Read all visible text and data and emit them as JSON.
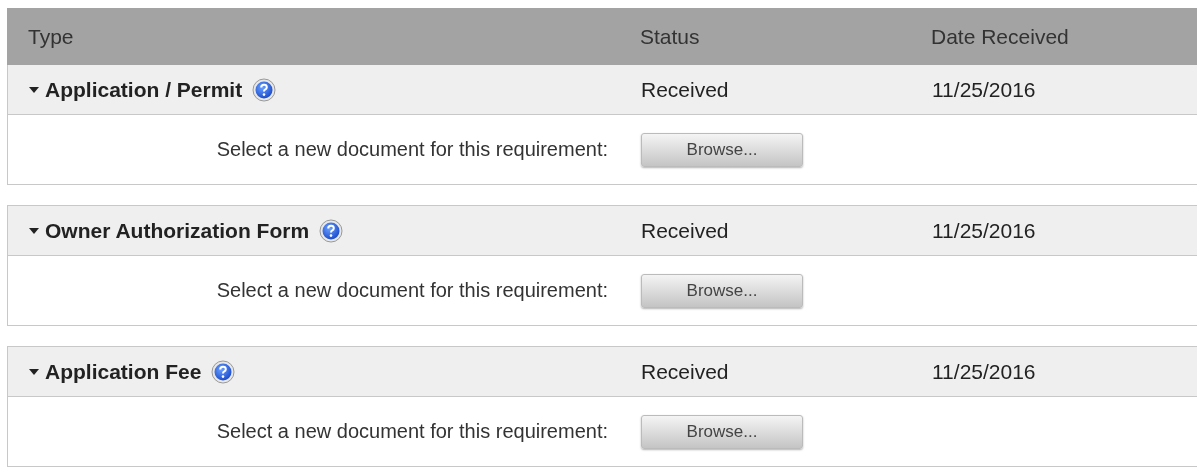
{
  "table": {
    "columns": [
      "Type",
      "Status",
      "Date Received"
    ],
    "groups": [
      {
        "type": "Application / Permit",
        "expanded": true,
        "status": "Received",
        "date": "11/25/2016",
        "prompt": "Select a new document for this requirement:",
        "button": "Browse..."
      },
      {
        "type": "Owner Authorization Form",
        "expanded": true,
        "status": "Received",
        "date": "11/25/2016",
        "prompt": "Select a new document for this requirement:",
        "button": "Browse..."
      },
      {
        "type": "Application Fee",
        "expanded": true,
        "status": "Received",
        "date": "11/25/2016",
        "prompt": "Select a new document for this requirement:",
        "button": "Browse..."
      }
    ]
  }
}
